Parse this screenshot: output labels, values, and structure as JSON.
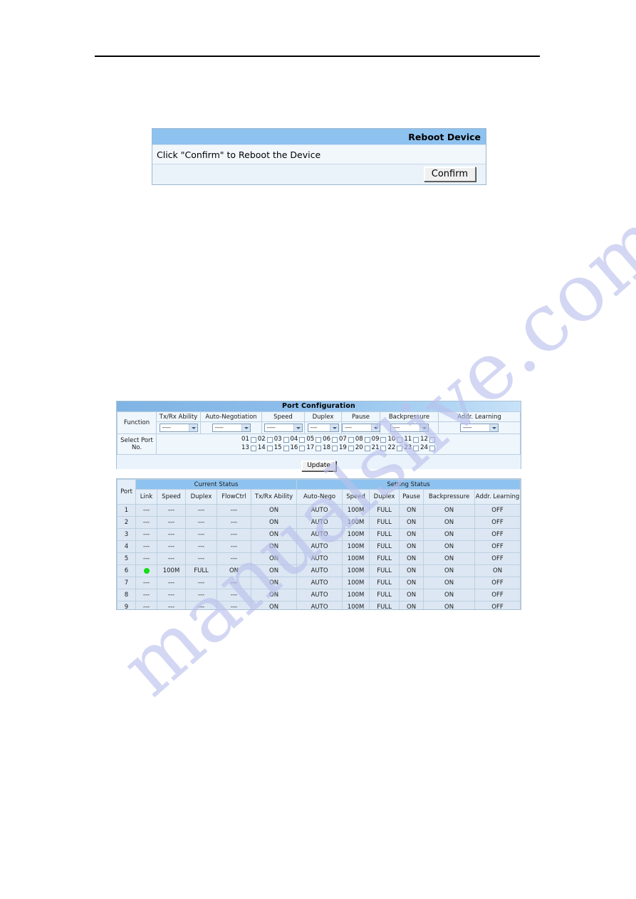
{
  "page": {
    "watermark": "manualslive.com"
  },
  "reboot_panel": {
    "title": "Reboot Device",
    "message": "Click \"Confirm\" to Reboot the Device",
    "confirm_label": "Confirm"
  },
  "port_configuration": {
    "title": "Port Configuration",
    "function_row_label": "Function",
    "select_row_label": "Select Port No.",
    "columns": [
      "Tx/Rx Ability",
      "Auto-Negotiation",
      "Speed",
      "Duplex",
      "Pause",
      "Backpressure",
      "Addr. Learning"
    ],
    "selects": [
      {
        "name": "tx-rx-ability",
        "value": "-----"
      },
      {
        "name": "auto-negotiation",
        "value": "-----"
      },
      {
        "name": "speed",
        "value": "-----"
      },
      {
        "name": "duplex",
        "value": "----"
      },
      {
        "name": "pause",
        "value": "----"
      },
      {
        "name": "backpressure",
        "value": "----"
      },
      {
        "name": "addr-learning",
        "value": "-----"
      }
    ],
    "port_numbers_row1": [
      "01",
      "02",
      "03",
      "04",
      "05",
      "06",
      "07",
      "08",
      "09",
      "10",
      "11",
      "12"
    ],
    "port_numbers_row2": [
      "13",
      "14",
      "15",
      "16",
      "17",
      "18",
      "19",
      "20",
      "21",
      "22",
      "23",
      "24"
    ],
    "update_label": "Update"
  },
  "status_table": {
    "port_header": "Port",
    "group_current": "Current Status",
    "group_setting": "Setting Status",
    "current_columns": [
      "Link",
      "Speed",
      "Duplex",
      "FlowCtrl",
      "Tx/Rx Ability"
    ],
    "setting_columns": [
      "Auto-Nego",
      "Speed",
      "Duplex",
      "Pause",
      "Backpressure",
      "Addr. Learning"
    ],
    "rows": [
      {
        "port": "1",
        "link": "---",
        "speed": "---",
        "duplex": "---",
        "flowctrl": "---",
        "txrx": "ON",
        "autonego": "AUTO",
        "set_speed": "100M",
        "set_duplex": "FULL",
        "pause": "ON",
        "backpressure": "ON",
        "addr_learning": "OFF"
      },
      {
        "port": "2",
        "link": "---",
        "speed": "---",
        "duplex": "---",
        "flowctrl": "---",
        "txrx": "ON",
        "autonego": "AUTO",
        "set_speed": "100M",
        "set_duplex": "FULL",
        "pause": "ON",
        "backpressure": "ON",
        "addr_learning": "OFF"
      },
      {
        "port": "3",
        "link": "---",
        "speed": "---",
        "duplex": "---",
        "flowctrl": "---",
        "txrx": "ON",
        "autonego": "AUTO",
        "set_speed": "100M",
        "set_duplex": "FULL",
        "pause": "ON",
        "backpressure": "ON",
        "addr_learning": "OFF"
      },
      {
        "port": "4",
        "link": "---",
        "speed": "---",
        "duplex": "---",
        "flowctrl": "---",
        "txrx": "ON",
        "autonego": "AUTO",
        "set_speed": "100M",
        "set_duplex": "FULL",
        "pause": "ON",
        "backpressure": "ON",
        "addr_learning": "OFF"
      },
      {
        "port": "5",
        "link": "---",
        "speed": "---",
        "duplex": "---",
        "flowctrl": "---",
        "txrx": "ON",
        "autonego": "AUTO",
        "set_speed": "100M",
        "set_duplex": "FULL",
        "pause": "ON",
        "backpressure": "ON",
        "addr_learning": "OFF"
      },
      {
        "port": "6",
        "link": "LED-GREEN",
        "speed": "100M",
        "duplex": "FULL",
        "flowctrl": "ON",
        "txrx": "ON",
        "autonego": "AUTO",
        "set_speed": "100M",
        "set_duplex": "FULL",
        "pause": "ON",
        "backpressure": "ON",
        "addr_learning": "ON"
      },
      {
        "port": "7",
        "link": "---",
        "speed": "---",
        "duplex": "---",
        "flowctrl": "---",
        "txrx": "ON",
        "autonego": "AUTO",
        "set_speed": "100M",
        "set_duplex": "FULL",
        "pause": "ON",
        "backpressure": "ON",
        "addr_learning": "OFF"
      },
      {
        "port": "8",
        "link": "---",
        "speed": "---",
        "duplex": "---",
        "flowctrl": "---",
        "txrx": "ON",
        "autonego": "AUTO",
        "set_speed": "100M",
        "set_duplex": "FULL",
        "pause": "ON",
        "backpressure": "ON",
        "addr_learning": "OFF"
      },
      {
        "port": "9",
        "link": "---",
        "speed": "---",
        "duplex": "---",
        "flowctrl": "---",
        "txrx": "ON",
        "autonego": "AUTO",
        "set_speed": "100M",
        "set_duplex": "FULL",
        "pause": "ON",
        "backpressure": "ON",
        "addr_learning": "OFF"
      }
    ]
  },
  "colors": {
    "banner_blue": "#8ec2ef",
    "panel_bg": "#eaf3fb",
    "row_bg": "#dce7f3",
    "led_green": "#11dd11",
    "watermark": "#b9c0ec"
  }
}
